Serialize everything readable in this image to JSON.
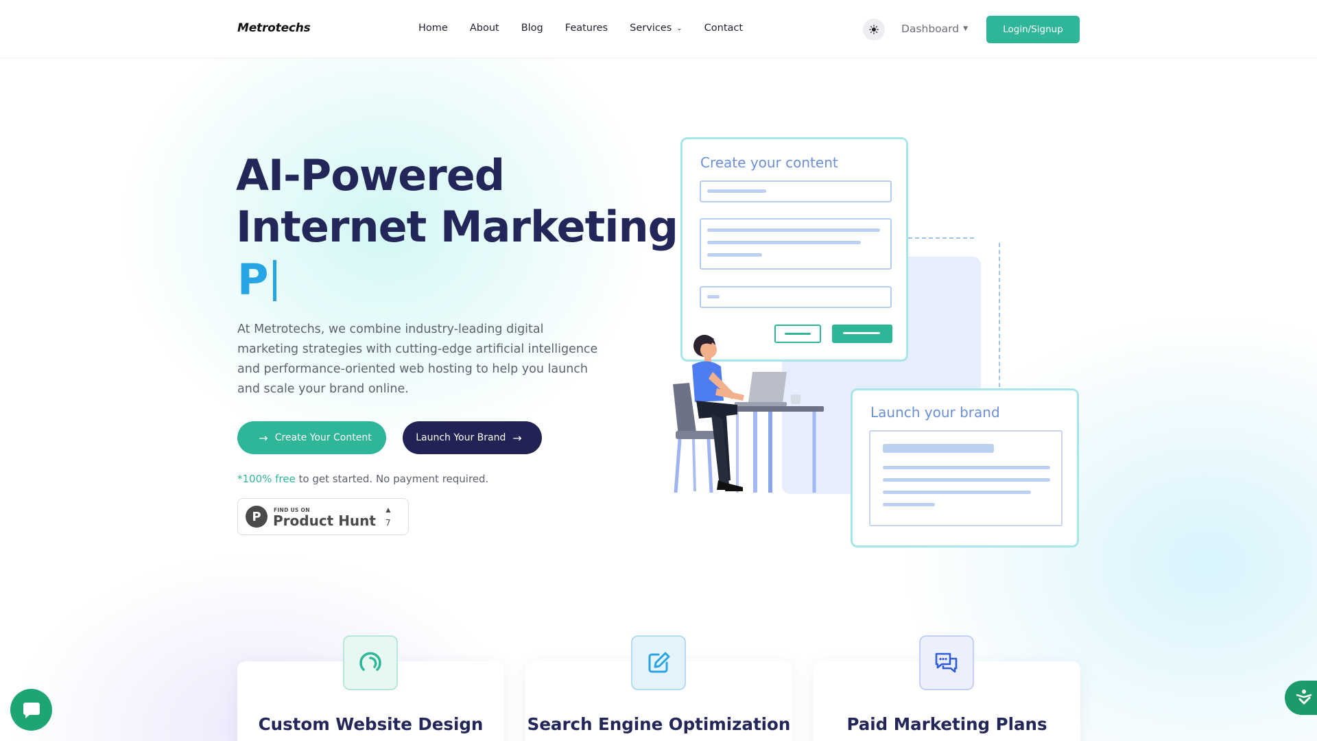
{
  "nav": {
    "brand": "Metrotechs",
    "links": [
      "Home",
      "About",
      "Blog",
      "Features",
      "Services",
      "Contact"
    ],
    "theme_icon": "sun-icon",
    "dashboard_label": "Dashboard",
    "login_label": "Login/Signup"
  },
  "hero": {
    "title_line1": "AI-Powered",
    "title_line2": "Internet Marketing",
    "typed_text": "P",
    "description": "At Metrotechs, we combine industry-leading digital marketing strategies with cutting-edge artificial intelligence and performance-oriented web hosting to help you launch and scale your brand online.",
    "btn_create": "Create Your Content",
    "btn_launch": "Launch Your Brand",
    "free_highlight": "*100% free",
    "free_rest": " to get started. No payment required.",
    "product_hunt": {
      "small": "FIND US ON",
      "big": "Product Hunt",
      "logo_letter": "P",
      "votes": "7"
    }
  },
  "illustration": {
    "card_create_title": "Create your content",
    "card_launch_title": "Launch your brand"
  },
  "features": [
    {
      "title": "Custom Website Design",
      "icon": "gauge-icon"
    },
    {
      "title": "Search Engine Optimization",
      "icon": "edit-icon"
    },
    {
      "title": "Paid Marketing Plans",
      "icon": "chat-icon"
    }
  ],
  "colors": {
    "accent": "#2fb597",
    "navy": "#232255",
    "typed": "#27a4e3",
    "heading": "#232658"
  }
}
